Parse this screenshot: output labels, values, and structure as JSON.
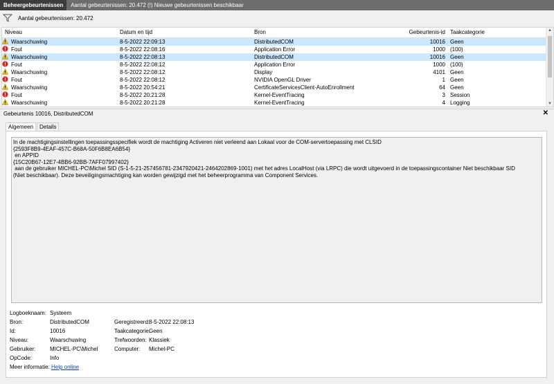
{
  "window": {
    "title": "Beheergebeurtenissen",
    "subtitle": "Aantal gebeurtenissen: 20.472 (!) Nieuwe gebeurtenissen beschikbaar"
  },
  "filter": {
    "label": "Aantal gebeurtenissen: 20.472"
  },
  "columns": {
    "level": "Niveau",
    "date": "Datum en tijd",
    "source": "Bron",
    "id": "Gebeurtenis-id",
    "category": "Taakcategorie"
  },
  "rows": [
    {
      "type": "warning",
      "level": "Waarschuwing",
      "date": "8-5-2022 22:09:13",
      "source": "DistributedCOM",
      "id": "10016",
      "category": "Geen"
    },
    {
      "type": "error",
      "level": "Fout",
      "date": "8-5-2022 22:08:16",
      "source": "Application Error",
      "id": "1000",
      "category": "(100)"
    },
    {
      "type": "warning",
      "level": "Waarschuwing",
      "date": "8-5-2022 22:08:13",
      "source": "DistributedCOM",
      "id": "10016",
      "category": "Geen"
    },
    {
      "type": "error",
      "level": "Fout",
      "date": "8-5-2022 22:08:12",
      "source": "Application Error",
      "id": "1000",
      "category": "(100)"
    },
    {
      "type": "warning",
      "level": "Waarschuwing",
      "date": "8-5-2022 22:08:12",
      "source": "Display",
      "id": "4101",
      "category": "Geen"
    },
    {
      "type": "error",
      "level": "Fout",
      "date": "8-5-2022 22:08:12",
      "source": "NVIDIA OpenGL Driver",
      "id": "1",
      "category": "Geen"
    },
    {
      "type": "warning",
      "level": "Waarschuwing",
      "date": "8-5-2022 20:54:21",
      "source": "CertificateServicesClient-AutoEnrollment",
      "id": "64",
      "category": "Geen"
    },
    {
      "type": "error",
      "level": "Fout",
      "date": "8-5-2022 20:21:28",
      "source": "Kernel-EventTracing",
      "id": "3",
      "category": "Session"
    },
    {
      "type": "warning",
      "level": "Waarschuwing",
      "date": "8-5-2022 20:21:28",
      "source": "Kernel-EventTracing",
      "id": "4",
      "category": "Logging"
    }
  ],
  "detail": {
    "title": "Gebeurtenis 10016, DistributedCOM",
    "close": "✕",
    "tabs": [
      "Algemeen",
      "Details"
    ],
    "description": "In de machtigingsinstellingen toepassingsspecifiek wordt de machtiging Activeren niet verleend aan Lokaal voor de COM-servertoepassing met CLSID \n{2593F8B9-4EAF-457C-B68A-50F6B8EA6B54}\n en APPID \n{15C20B67-12E7-4BB6-92BB-7AFF07997402}\n aan de gebruiker MICHEL-PC\\Michel SID (S-1-5-21-257456781-2347920421-2464202869-1001) met het adres LocalHost (via LRPC) die wordt uitgevoerd in de toepassingscontainer Niet beschikbaar SID (Niet beschikbaar). Deze beveiligingsmachtiging kan worden gewijzigd met het beheerprogramma van Component Services.",
    "props": {
      "log_label": "Logboeknaam:",
      "log_value": "Systeem",
      "source_label": "Bron:",
      "source_value": "DistributedCOM",
      "recorded_label": "Geregistreerd:",
      "recorded_value": "8-5-2022 22:08:13",
      "id_label": "Id:",
      "id_value": "10016",
      "taskcat_label": "Taakcategorie:",
      "taskcat_value": "Geen",
      "level_label": "Niveau:",
      "level_value": "Waarschuwing",
      "keywords_label": "Trefwoorden:",
      "keywords_value": "Klassiek",
      "user_label": "Gebruiker:",
      "user_value": "MICHEL-PC\\Michel",
      "computer_label": "Computer:",
      "computer_value": "Michel-PC",
      "opcode_label": "OpCode:",
      "opcode_value": "Info",
      "more_label": "Meer informatie:",
      "more_link": "Help online"
    }
  },
  "colors": {
    "selected_row": "#cce8ff",
    "warning": "#f5c400",
    "error": "#d62828"
  }
}
